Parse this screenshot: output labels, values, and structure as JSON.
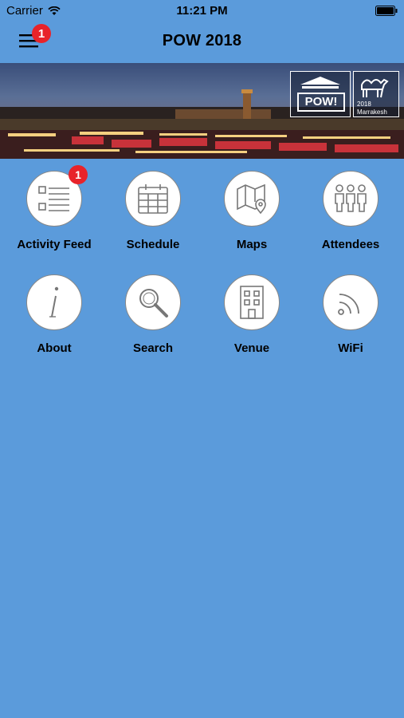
{
  "status_bar": {
    "carrier": "Carrier",
    "time": "11:21 PM"
  },
  "nav": {
    "title": "POW 2018",
    "menu_badge": "1"
  },
  "banner": {
    "logo_pow": "POW!",
    "logo_year": "2018",
    "logo_city": "Marrakesh"
  },
  "tiles": [
    {
      "label": "Activity Feed",
      "icon": "list-icon",
      "badge": "1"
    },
    {
      "label": "Schedule",
      "icon": "calendar-icon"
    },
    {
      "label": "Maps",
      "icon": "map-icon"
    },
    {
      "label": "Attendees",
      "icon": "people-icon"
    },
    {
      "label": "About",
      "icon": "info-icon"
    },
    {
      "label": "Search",
      "icon": "search-icon"
    },
    {
      "label": "Venue",
      "icon": "building-icon"
    },
    {
      "label": "WiFi",
      "icon": "wifi-icon"
    }
  ],
  "colors": {
    "background": "#5b9bdb",
    "badge": "#e8232a"
  }
}
